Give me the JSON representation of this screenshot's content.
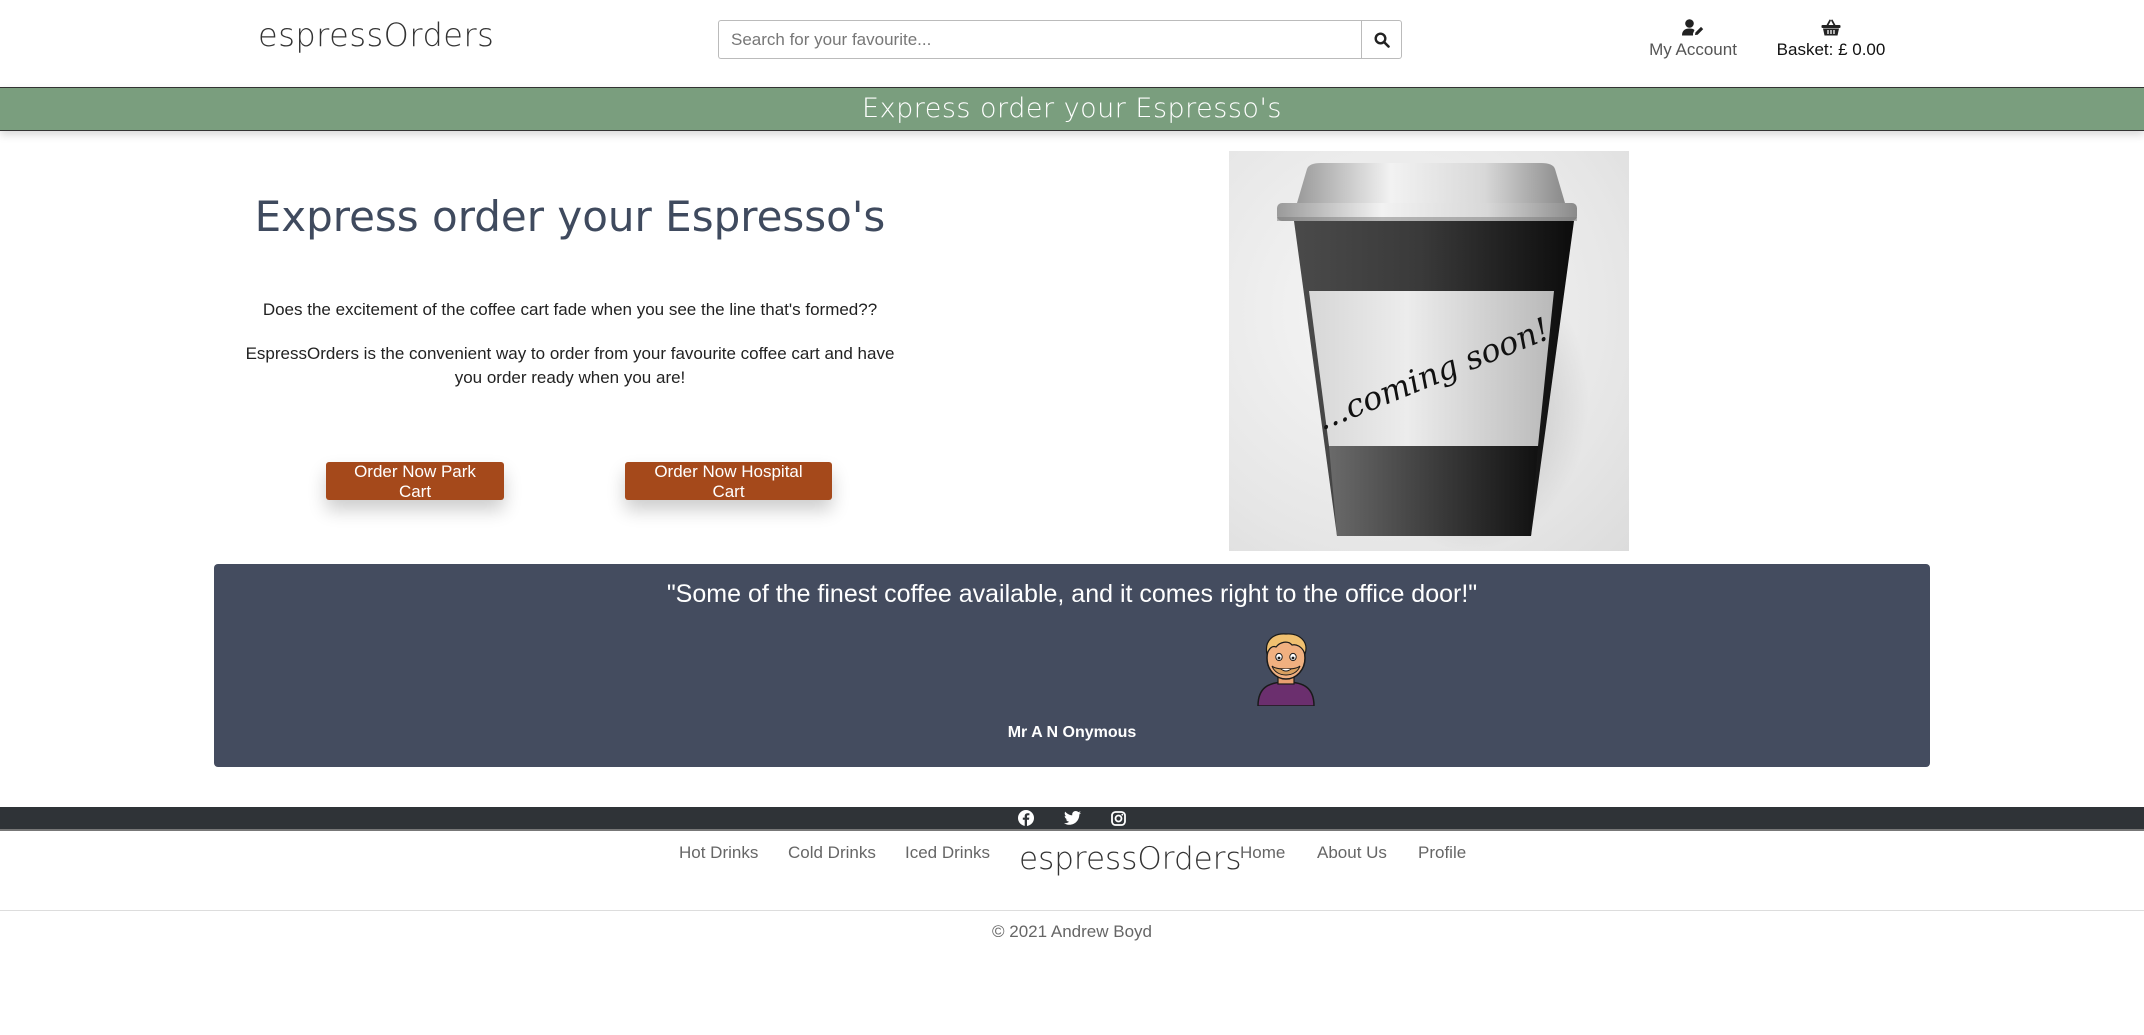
{
  "header": {
    "logo": "espressOrders",
    "search": {
      "placeholder": "Search for your favourite..."
    },
    "account_label": "My Account",
    "basket_label": "Basket: £ 0.00"
  },
  "banner": {
    "text": "Express order your Espresso's"
  },
  "hero": {
    "title": "Express order your Espresso's",
    "paragraph1": "Does the excitement of the coffee cart fade when you see the line that's formed??",
    "paragraph2": "EspressOrders is the convenient way to order from your favourite coffee cart and have you order ready when you are!",
    "buttons": {
      "park": "Order Now Park Cart",
      "hospital": "Order Now Hospital Cart"
    },
    "cup_text": "...coming soon!"
  },
  "testimonial": {
    "quote": "\"Some of the finest coffee available, and it comes right to the office door!\"",
    "author": "Mr A N Onymous"
  },
  "social": {
    "icons": [
      "facebook-icon",
      "twitter-icon",
      "instagram-icon"
    ]
  },
  "footer": {
    "links": [
      "Hot Drinks",
      "Cold Drinks",
      "Iced Drinks",
      "Home",
      "About Us",
      "Profile"
    ],
    "logo": "espressOrders",
    "copyright": "© 2021 Andrew Boyd"
  },
  "colors": {
    "banner": "#7a9e7e",
    "order_button": "#a5491b",
    "testimonial_bg": "#444c5f",
    "title_text": "#3f4a5e",
    "social_bar": "#2f3337"
  }
}
